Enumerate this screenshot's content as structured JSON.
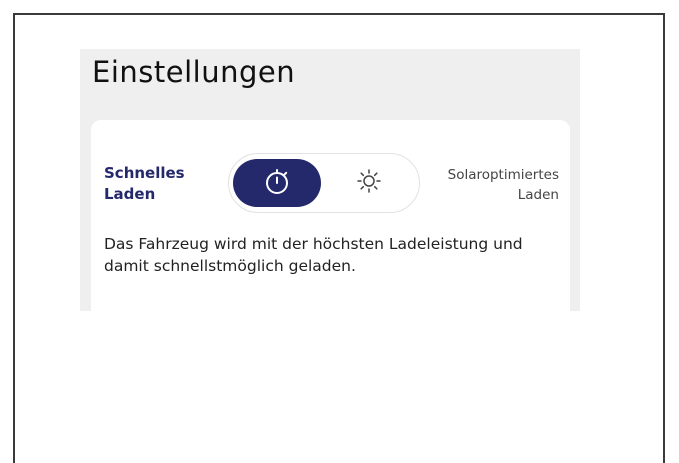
{
  "page": {
    "title": "Einstellungen"
  },
  "charging_mode": {
    "fast_label": "Schnelles Laden",
    "solar_label": "Solaroptimiertes Laden",
    "selected": "fast",
    "fast_icon": "stopwatch-icon",
    "solar_icon": "sun-icon",
    "accent_color": "#23296b",
    "description": "Das Fahrzeug wird mit der höchsten Ladeleistung und damit schnellstmöglich geladen."
  }
}
